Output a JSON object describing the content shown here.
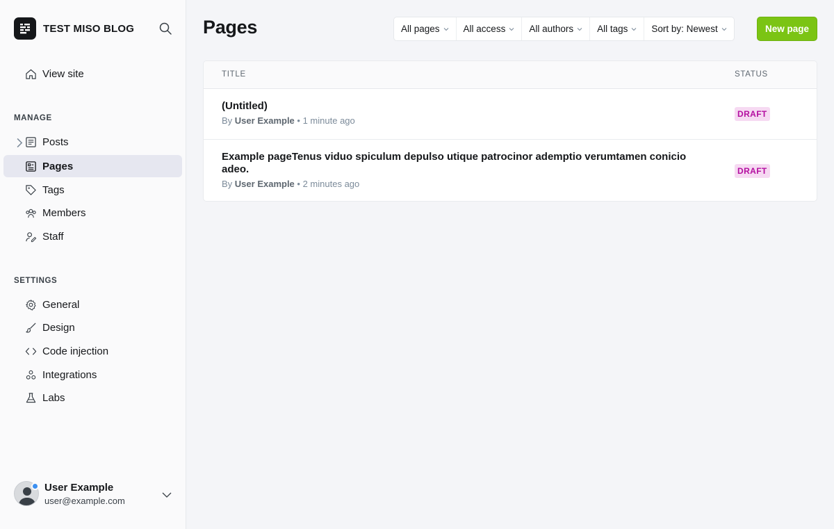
{
  "sidebar": {
    "brand": {
      "name": "TEST MISO BLOG"
    },
    "view_site": "View site",
    "manage_label": "MANAGE",
    "manage_items": [
      {
        "label": "Posts",
        "icon": "posts-icon"
      },
      {
        "label": "Pages",
        "icon": "pages-icon",
        "active": true
      },
      {
        "label": "Tags",
        "icon": "tag-icon"
      },
      {
        "label": "Members",
        "icon": "members-icon"
      },
      {
        "label": "Staff",
        "icon": "staff-icon"
      }
    ],
    "settings_label": "SETTINGS",
    "settings_items": [
      {
        "label": "General",
        "icon": "gear-icon"
      },
      {
        "label": "Design",
        "icon": "brush-icon"
      },
      {
        "label": "Code injection",
        "icon": "code-icon"
      },
      {
        "label": "Integrations",
        "icon": "integrations-icon"
      },
      {
        "label": "Labs",
        "icon": "flask-icon"
      }
    ],
    "user": {
      "name": "User Example",
      "email": "user@example.com"
    }
  },
  "main": {
    "title": "Pages",
    "filters": [
      "All pages",
      "All access",
      "All authors",
      "All tags",
      "Sort by: Newest"
    ],
    "new_button": "New page",
    "table": {
      "headers": {
        "title": "TITLE",
        "status": "STATUS"
      },
      "rows": [
        {
          "title": "(Untitled)",
          "by": "By",
          "author": "User Example",
          "time": "1 minute ago",
          "status": "DRAFT"
        },
        {
          "title": "Example pageTenus viduo spiculum depulso utique patrocinor ademptio verumtamen conicio adeo.",
          "by": "By",
          "author": "User Example",
          "time": "2 minutes ago",
          "status": "DRAFT"
        }
      ]
    }
  },
  "colors": {
    "accent": "#7bc414",
    "active_nav": "#e6e7f0",
    "draft_bg": "#f6d9f2",
    "draft_text": "#b40fa0",
    "avatar_dot": "#3b8ff0"
  }
}
